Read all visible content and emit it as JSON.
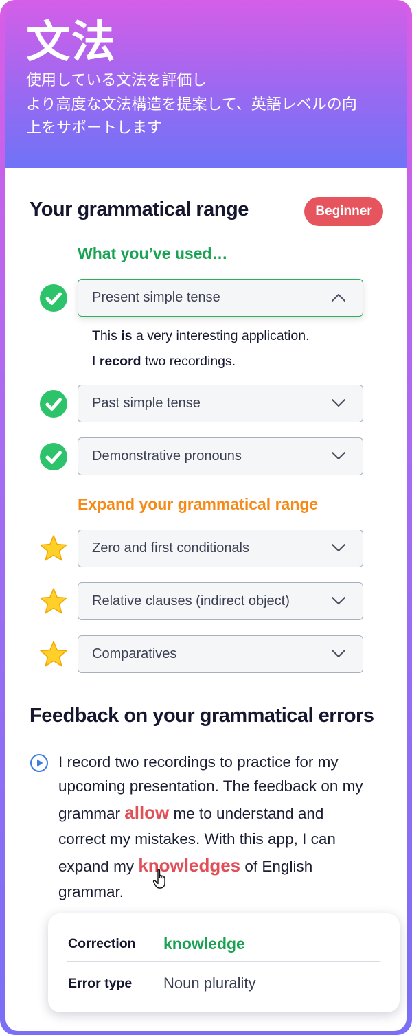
{
  "header": {
    "title": "文法",
    "description_lines": [
      "使用している文法を評価し",
      "より高度な文法構造を提案して、英語レベルの向",
      "上をサポートします"
    ]
  },
  "range_section": {
    "title": "Your grammatical range",
    "level_badge": "Beginner",
    "used_heading": "What you’ve used…",
    "expand_heading": "Expand your grammatical range",
    "used_items": [
      {
        "label": "Present simple tense",
        "expanded": true,
        "icon": "check-circle-icon",
        "examples": [
          {
            "before": "This ",
            "bold": "is",
            "after": " a very interesting application."
          },
          {
            "before": "I ",
            "bold": "record",
            "after": " two recordings."
          }
        ]
      },
      {
        "label": "Past simple tense",
        "expanded": false,
        "icon": "check-circle-icon"
      },
      {
        "label": "Demonstrative pronouns",
        "expanded": false,
        "icon": "check-circle-icon"
      }
    ],
    "expand_items": [
      {
        "label": "Zero and first conditionals",
        "icon": "star-icon"
      },
      {
        "label": "Relative clauses (indirect object)",
        "icon": "star-icon"
      },
      {
        "label": "Comparatives",
        "icon": "star-icon"
      }
    ]
  },
  "feedback_section": {
    "title": "Feedback on your grammatical errors",
    "play_icon": "play-circle-icon",
    "text": {
      "line1": "I record two recordings to practice for my",
      "line2": "upcoming presentation. The feedback on my",
      "line3_before": "grammar ",
      "line3_error": "allow",
      "line3_after": " me to understand and",
      "line4": "correct my mistakes. With this app, I can",
      "line5_before": "expand my ",
      "line5_error": "knowledges",
      "line5_after": " of English",
      "line6": "grammar."
    },
    "correction_card": {
      "correction_label": "Correction",
      "correction_value": "knowledge",
      "error_type_label": "Error type",
      "error_type_value": "Noun plurality"
    }
  },
  "colors": {
    "accent_green": "#1aa253",
    "accent_orange": "#f58a18",
    "badge_red": "#e6555d",
    "error_red": "#e14f58",
    "gradient_top": "#d95de6",
    "gradient_bottom": "#6f73f7"
  }
}
